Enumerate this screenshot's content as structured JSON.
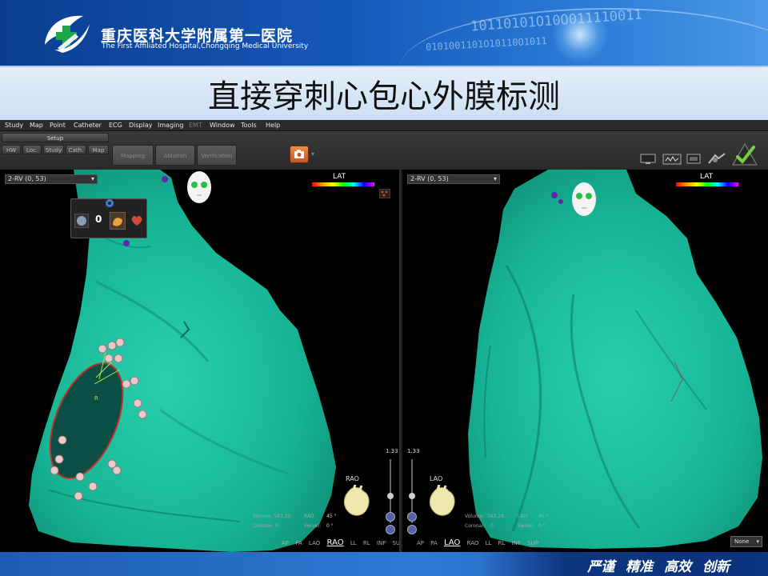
{
  "header": {
    "hospital_cn": "重庆医科大学附属第一医院",
    "hospital_en": "The First Affiliated Hospital,Chongqing Medical University",
    "binary_line1": "10110101O10O011110011",
    "binary_line2": "0101001101O10110O1011"
  },
  "slide": {
    "title": "直接穿刺心包心外膜标测"
  },
  "app": {
    "menu": {
      "study": "Study",
      "map": "Map",
      "point": "Point",
      "catheter": "Catheter",
      "ecg": "ECG",
      "display": "Display",
      "imaging": "Imaging",
      "dimmed": "EMT",
      "window": "Window",
      "tools": "Tools",
      "help": "Help"
    },
    "toolbar": {
      "setup": "Setup",
      "hw": "HW",
      "loc": "Loc.",
      "study": "Study",
      "cath": "Cath.",
      "map": "Map",
      "mapping": "Mapping",
      "ablation": "Ablation",
      "verification": "Verification"
    },
    "left_view": {
      "map_select": "2-RV (0, 53)",
      "lat": "LAT",
      "zoom": "1.33",
      "points_count": "0",
      "orientation": "RAO",
      "volume_label": "Volume:",
      "volume_value": "583.29",
      "coronal_label": "Coronal:",
      "coronal_value": "0",
      "rao_label": "RAO",
      "rao_value": "45 °",
      "swivel_label": "Swivel:",
      "swivel_value": "0 °",
      "views": [
        "AP",
        "PA",
        "LAO",
        "RAO",
        "LL",
        "RL",
        "INF",
        "SUP"
      ],
      "selected_view": "RAO",
      "marker": "R"
    },
    "right_view": {
      "map_select": "2-RV (0, 53)",
      "lat": "LAT",
      "zoom": "1.33",
      "orientation": "LAO",
      "volume_label": "Volume:",
      "volume_value": "583.29",
      "coronal_label": "Coronal:",
      "coronal_value": "0",
      "lao_label": "LAO",
      "lao_value": "45 °",
      "swivel_label": "Swivel:",
      "swivel_value": "0 °",
      "views": [
        "AP",
        "PA",
        "LAO",
        "RAO",
        "LL",
        "RL",
        "INF",
        "SUP"
      ],
      "selected_view": "LAO",
      "none_select": "None"
    }
  },
  "footer": {
    "slogan": "严谨 精准 高效 创新"
  },
  "colors": {
    "mesh": "#1ab99a",
    "banner": "#1558b8",
    "lesion_outline": "#c0302a"
  }
}
